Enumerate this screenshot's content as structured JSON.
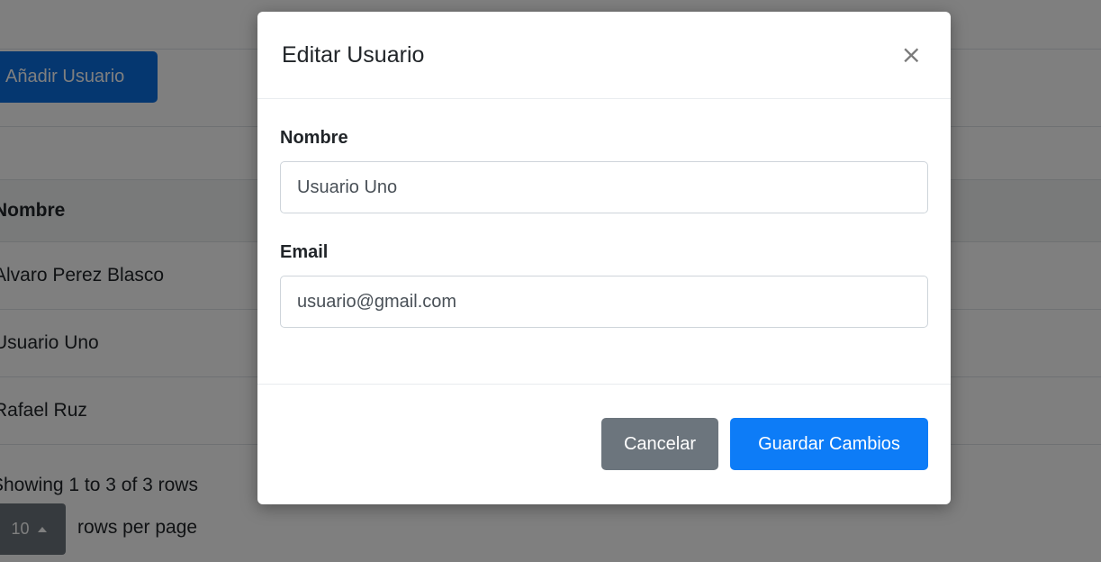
{
  "background": {
    "add_user_label": "Añadir Usuario",
    "table": {
      "header": "Nombre",
      "rows": [
        "Alvaro Perez Blasco",
        "Usuario Uno",
        "Rafael Ruz"
      ]
    },
    "pagination_info": "Showing 1 to 3 of 3 rows",
    "page_size": "10",
    "page_size_icon": "caret-up-icon",
    "rows_per_page_label": "rows per page"
  },
  "modal": {
    "title": "Editar Usuario",
    "close_glyph": "×",
    "fields": {
      "name_label": "Nombre",
      "name_value": "Usuario Uno",
      "email_label": "Email",
      "email_value": "usuario@gmail.com"
    },
    "cancel_label": "Cancelar",
    "save_label": "Guardar Cambios"
  },
  "colors": {
    "primary": "#0d7cf7",
    "secondary": "#6c757d",
    "backdrop": "rgba(0,0,0,0.5)"
  }
}
